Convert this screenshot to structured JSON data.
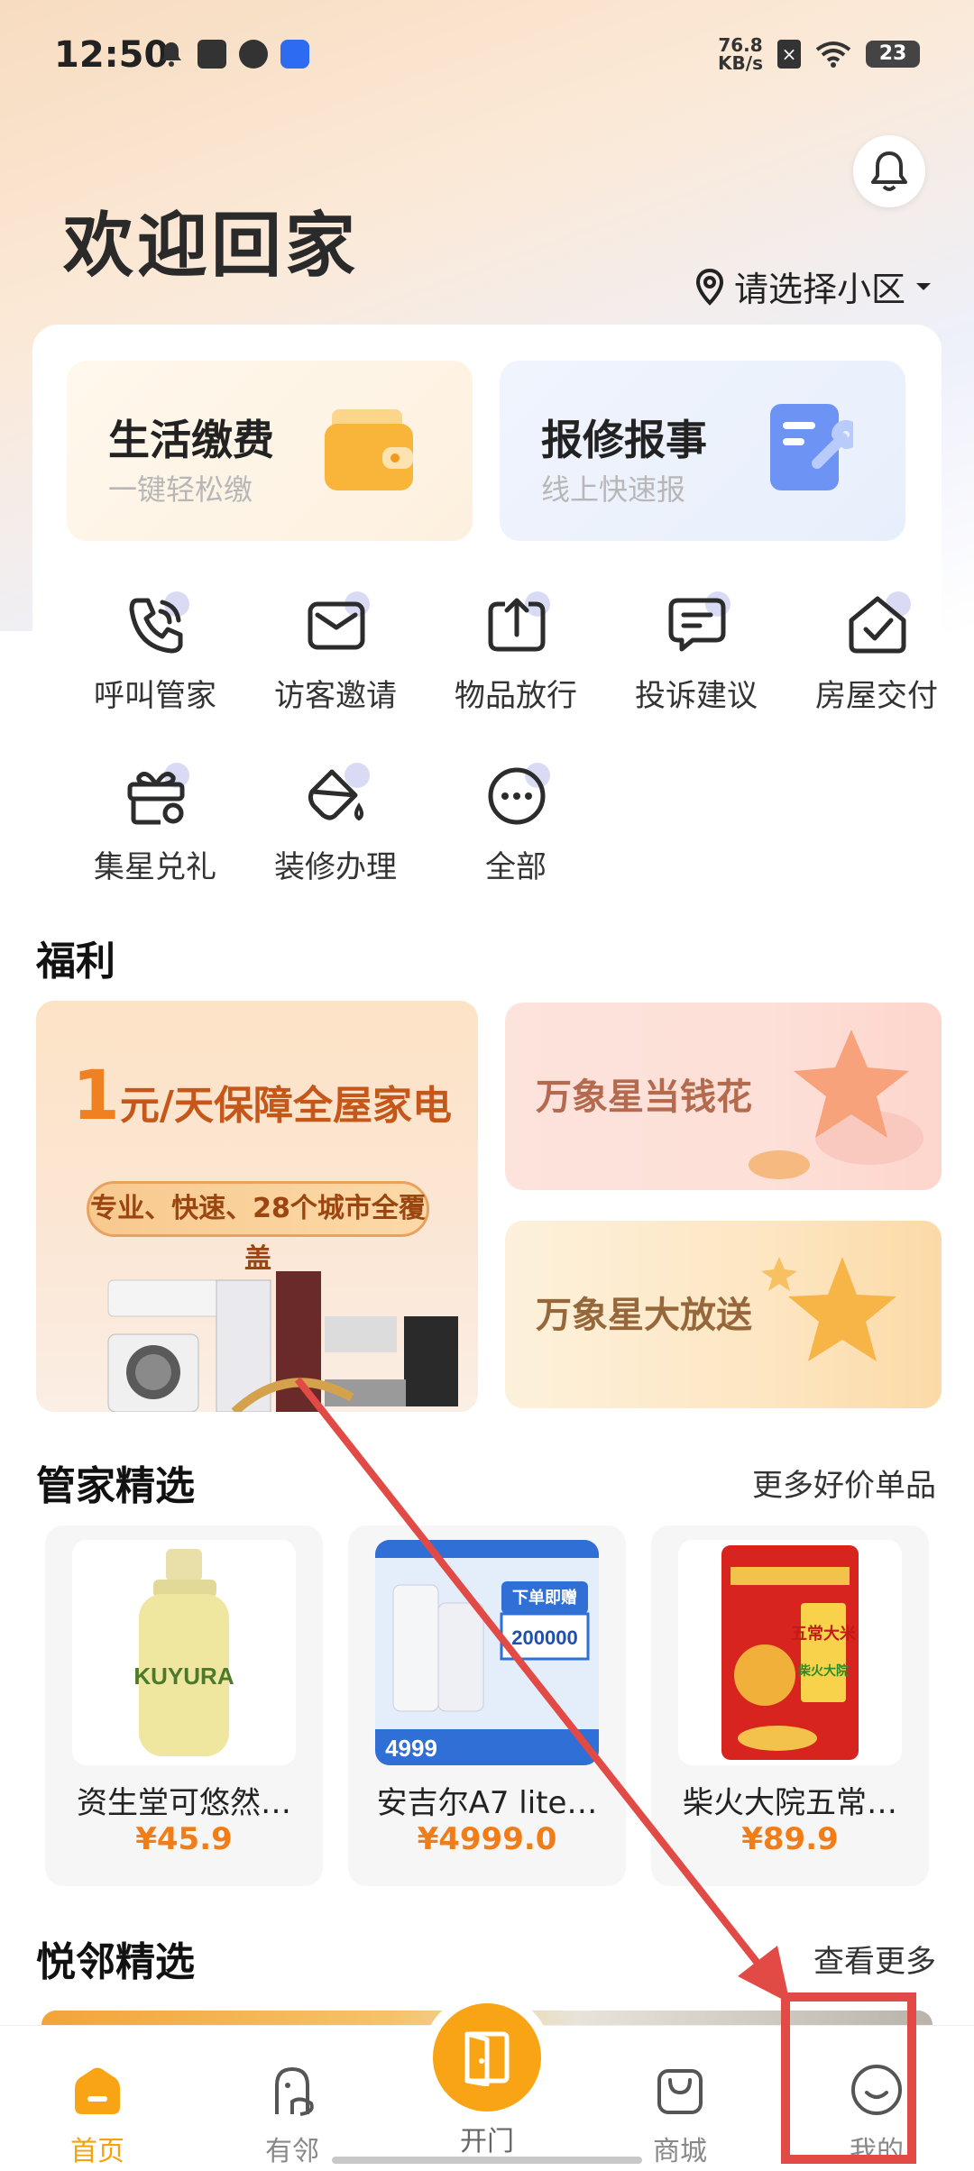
{
  "status_bar": {
    "time": "12:50",
    "net_speed_value": "76.8",
    "net_speed_unit": "KB/s",
    "sim_indicator": "×",
    "battery": "23"
  },
  "header": {
    "title": "欢迎回家",
    "community_select": "请选择小区"
  },
  "feature_cards": [
    {
      "title": "生活缴费",
      "subtitle": "一键轻松缴"
    },
    {
      "title": "报修报事",
      "subtitle": "线上快速报"
    }
  ],
  "services": [
    {
      "label": "呼叫管家",
      "icon": "phone-icon"
    },
    {
      "label": "访客邀请",
      "icon": "mail-icon"
    },
    {
      "label": "物品放行",
      "icon": "upload-icon"
    },
    {
      "label": "投诉建议",
      "icon": "message-icon"
    },
    {
      "label": "房屋交付",
      "icon": "house-check-icon"
    },
    {
      "label": "集星兑礼",
      "icon": "gift-icon"
    },
    {
      "label": "装修办理",
      "icon": "paint-bucket-icon"
    },
    {
      "label": "全部",
      "icon": "more-icon"
    }
  ],
  "welfare": {
    "title": "福利",
    "big_banner": {
      "headline_num": "1",
      "headline_rest": "元/天保障全屋家电",
      "pill": "专业、快速、28个城市全覆盖"
    },
    "small_banners": [
      {
        "title": "万象星当钱花"
      },
      {
        "title": "万象星大放送"
      }
    ]
  },
  "steward_picks": {
    "title": "管家精选",
    "more": "更多好价单品",
    "products": [
      {
        "name": "资生堂可悠然…",
        "price": "¥45.9"
      },
      {
        "name": "安吉尔A7 lite…",
        "price": "¥4999.0"
      },
      {
        "name": "柴火大院五常…",
        "price": "¥89.9"
      }
    ],
    "product_image_text": {
      "kuyura": "KUYURA",
      "promo_top": "下单即赠",
      "promo_amount": "200000",
      "promo_price": "4999",
      "rice_label": "五常大米",
      "rice_brand": "柴火大院"
    }
  },
  "neighbor_picks": {
    "title": "悦邻精选",
    "more": "查看更多"
  },
  "bottom_nav": [
    {
      "label": "首页",
      "icon": "home-icon",
      "active": true
    },
    {
      "label": "有邻",
      "icon": "neighbor-icon",
      "active": false
    },
    {
      "label": "开门",
      "icon": "door-icon",
      "active": false
    },
    {
      "label": "商城",
      "icon": "shopping-bag-icon",
      "active": false
    },
    {
      "label": "我的",
      "icon": "smile-face-icon",
      "active": false
    }
  ],
  "colors": {
    "accent": "#f8a414",
    "price": "#f07d18",
    "annotation": "#e24a46"
  }
}
